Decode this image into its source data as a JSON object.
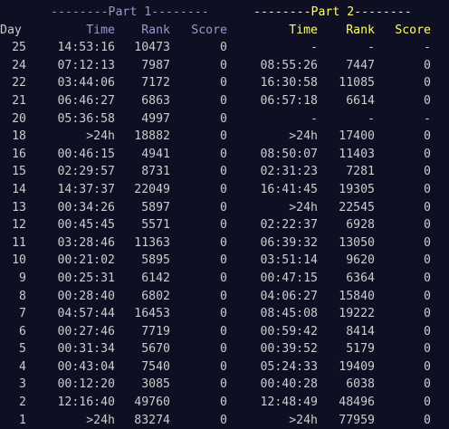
{
  "colors": {
    "background": "#0f0f23",
    "text": "#cccccc",
    "part1": "#9999cc",
    "part2": "#ffff66"
  },
  "header": {
    "part1_title": "--------Part 1--------",
    "part2_title": "--------Part 2--------",
    "day_label": "Day",
    "time_label": "Time",
    "rank_label": "Rank",
    "score_label": "Score"
  },
  "rows": [
    {
      "day": "25",
      "t1": "14:53:16",
      "r1": "10473",
      "s1": "0",
      "t2": "-",
      "r2": "-",
      "s2": "-"
    },
    {
      "day": "24",
      "t1": "07:12:13",
      "r1": "7987",
      "s1": "0",
      "t2": "08:55:26",
      "r2": "7447",
      "s2": "0"
    },
    {
      "day": "22",
      "t1": "03:44:06",
      "r1": "7172",
      "s1": "0",
      "t2": "16:30:58",
      "r2": "11085",
      "s2": "0"
    },
    {
      "day": "21",
      "t1": "06:46:27",
      "r1": "6863",
      "s1": "0",
      "t2": "06:57:18",
      "r2": "6614",
      "s2": "0"
    },
    {
      "day": "20",
      "t1": "05:36:58",
      "r1": "4997",
      "s1": "0",
      "t2": "-",
      "r2": "-",
      "s2": "-"
    },
    {
      "day": "18",
      "t1": ">24h",
      "r1": "18882",
      "s1": "0",
      "t2": ">24h",
      "r2": "17400",
      "s2": "0"
    },
    {
      "day": "16",
      "t1": "00:46:15",
      "r1": "4941",
      "s1": "0",
      "t2": "08:50:07",
      "r2": "11403",
      "s2": "0"
    },
    {
      "day": "15",
      "t1": "02:29:57",
      "r1": "8731",
      "s1": "0",
      "t2": "02:31:23",
      "r2": "7281",
      "s2": "0"
    },
    {
      "day": "14",
      "t1": "14:37:37",
      "r1": "22049",
      "s1": "0",
      "t2": "16:41:45",
      "r2": "19305",
      "s2": "0"
    },
    {
      "day": "13",
      "t1": "00:34:26",
      "r1": "5897",
      "s1": "0",
      "t2": ">24h",
      "r2": "22545",
      "s2": "0"
    },
    {
      "day": "12",
      "t1": "00:45:45",
      "r1": "5571",
      "s1": "0",
      "t2": "02:22:37",
      "r2": "6928",
      "s2": "0"
    },
    {
      "day": "11",
      "t1": "03:28:46",
      "r1": "11363",
      "s1": "0",
      "t2": "06:39:32",
      "r2": "13050",
      "s2": "0"
    },
    {
      "day": "10",
      "t1": "00:21:02",
      "r1": "5895",
      "s1": "0",
      "t2": "03:51:14",
      "r2": "9620",
      "s2": "0"
    },
    {
      "day": "9",
      "t1": "00:25:31",
      "r1": "6142",
      "s1": "0",
      "t2": "00:47:15",
      "r2": "6364",
      "s2": "0"
    },
    {
      "day": "8",
      "t1": "00:28:40",
      "r1": "6802",
      "s1": "0",
      "t2": "04:06:27",
      "r2": "15840",
      "s2": "0"
    },
    {
      "day": "7",
      "t1": "04:57:44",
      "r1": "16453",
      "s1": "0",
      "t2": "08:45:08",
      "r2": "19222",
      "s2": "0"
    },
    {
      "day": "6",
      "t1": "00:27:46",
      "r1": "7719",
      "s1": "0",
      "t2": "00:59:42",
      "r2": "8414",
      "s2": "0"
    },
    {
      "day": "5",
      "t1": "00:31:34",
      "r1": "5670",
      "s1": "0",
      "t2": "00:39:52",
      "r2": "5179",
      "s2": "0"
    },
    {
      "day": "4",
      "t1": "00:43:04",
      "r1": "7540",
      "s1": "0",
      "t2": "05:24:33",
      "r2": "19409",
      "s2": "0"
    },
    {
      "day": "3",
      "t1": "00:12:20",
      "r1": "3085",
      "s1": "0",
      "t2": "00:40:28",
      "r2": "6038",
      "s2": "0"
    },
    {
      "day": "2",
      "t1": "12:16:40",
      "r1": "49760",
      "s1": "0",
      "t2": "12:48:49",
      "r2": "48496",
      "s2": "0"
    },
    {
      "day": "1",
      "t1": ">24h",
      "r1": "83274",
      "s1": "0",
      "t2": ">24h",
      "r2": "77959",
      "s2": "0"
    }
  ]
}
